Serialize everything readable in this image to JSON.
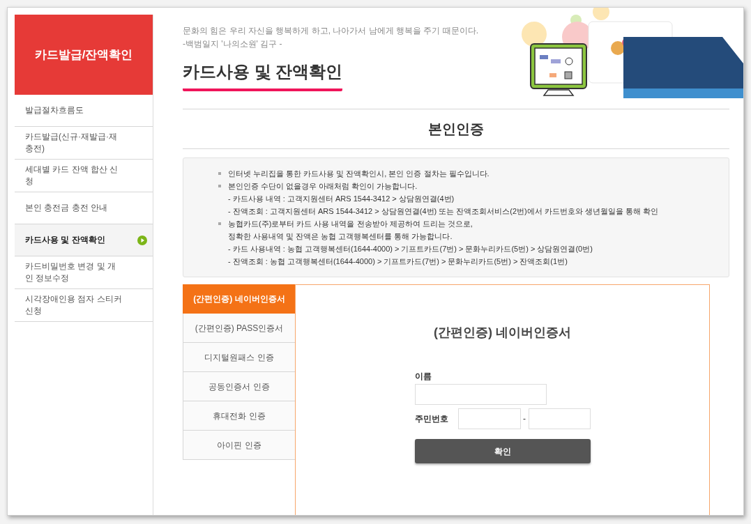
{
  "sidebar": {
    "title": "카드발급/잔액확인",
    "items": [
      {
        "label": "발급절차흐름도",
        "selected": false
      },
      {
        "label": "카드발급(신규·재발급·재충전)",
        "selected": false
      },
      {
        "label": "세대별 카드 잔액 합산 신청",
        "selected": false
      },
      {
        "label": "본인 충전금 충전 안내",
        "selected": false
      },
      {
        "label": "카드사용 및 잔액확인",
        "selected": true
      },
      {
        "label": "카드비밀번호 변경 및 개인 정보수정",
        "selected": false
      },
      {
        "label": "시각장애인용 점자 스티커 신청",
        "selected": false
      }
    ]
  },
  "quote": {
    "text": "문화의 힘은 우리 자신을 행복하게 하고, 나아가서 남에게 행복을 주기 때문이다.",
    "source": "-백범일지 '나의소원' 김구 -"
  },
  "page_title": "카드사용 및 잔액확인",
  "section_title": "본인인증",
  "notice": [
    {
      "kind": "bullet",
      "text": "인터넷 누리집을 통한 카드사용 및 잔액확인시, 본인 인증 절차는 필수입니다."
    },
    {
      "kind": "bullet",
      "text": "본인인증 수단이 없을경우 아래처럼 확인이 가능합니다."
    },
    {
      "kind": "line",
      "text": "- 카드사용 내역 : 고객지원센터 ARS 1544-3412 > 상담원연결(4번)"
    },
    {
      "kind": "line",
      "text": "- 잔액조회 : 고객지원센터 ARS 1544-3412 > 상담원연결(4번) 또는 잔액조회서비스(2번)에서 카드번호와 생년월일을 통해 확인"
    },
    {
      "kind": "bullet",
      "text": "농협카드(주)로부터 카드 사용 내역을 전송받아 제공하여 드리는 것으로,"
    },
    {
      "kind": "line",
      "text": "정확한 사용내역 및 잔액은 농협 고객행복센터를 통해 가능합니다."
    },
    {
      "kind": "line",
      "text": "- 카드 사용내역 : 농협 고객행복센터(1644-4000) > 기프트카드(7번) > 문화누리카드(5번) > 상담원연결(0번)"
    },
    {
      "kind": "line",
      "text": "- 잔액조회 : 농협 고객행복센터(1644-4000) > 기프트카드(7번) > 문화누리카드(5번) > 잔액조회(1번)"
    }
  ],
  "auth_tabs": [
    {
      "label": "(간편인증) 네이버인증서",
      "selected": true
    },
    {
      "label": "(간편인증) PASS인증서",
      "selected": false
    },
    {
      "label": "디지털원패스 인증",
      "selected": false
    },
    {
      "label": "공동인증서 인증",
      "selected": false
    },
    {
      "label": "휴대전화 인증",
      "selected": false
    },
    {
      "label": "아이핀 인증",
      "selected": false
    }
  ],
  "form": {
    "title": "(간편인증) 네이버인증서",
    "name_label": "이름",
    "rrn_label": "주민번호",
    "separator": "-",
    "submit": "확인"
  }
}
